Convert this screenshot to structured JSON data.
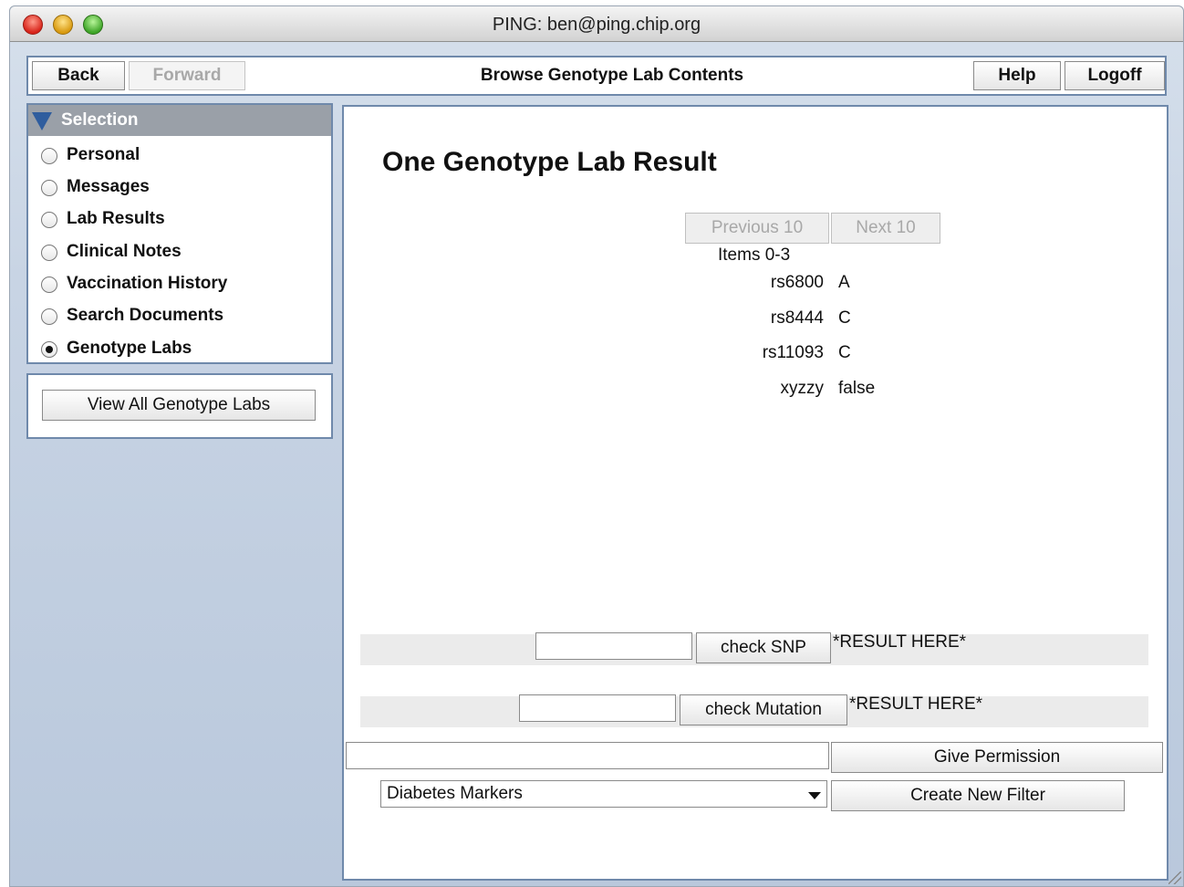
{
  "window": {
    "title": "PING: ben@ping.chip.org"
  },
  "navbar": {
    "back_label": "Back",
    "forward_label": "Forward",
    "title": "Browse Genotype Lab Contents",
    "help_label": "Help",
    "logoff_label": "Logoff"
  },
  "selection": {
    "header": "Selection",
    "items": [
      {
        "label": "Personal",
        "selected": false
      },
      {
        "label": "Messages",
        "selected": false
      },
      {
        "label": "Lab Results",
        "selected": false
      },
      {
        "label": "Clinical Notes",
        "selected": false
      },
      {
        "label": "Vaccination History",
        "selected": false
      },
      {
        "label": "Search Documents",
        "selected": false
      },
      {
        "label": "Genotype Labs",
        "selected": true
      }
    ],
    "view_all_label": "View All Genotype Labs"
  },
  "main": {
    "heading": "One Genotype Lab Result",
    "prev_label": "Previous 10",
    "next_label": "Next 10",
    "items_range": "Items 0-3",
    "results": [
      {
        "key": "rs6800",
        "value": "A"
      },
      {
        "key": "rs8444",
        "value": "C"
      },
      {
        "key": "rs11093",
        "value": "C"
      },
      {
        "key": "xyzzy",
        "value": "false"
      }
    ],
    "snp_input_value": "",
    "check_snp_label": "check SNP",
    "snp_result": "*RESULT HERE*",
    "mutation_input_value": "",
    "check_mutation_label": "check Mutation",
    "mutation_result": "*RESULT HERE*",
    "permission_input_value": "",
    "give_permission_label": "Give Permission",
    "filter_selected": "Diabetes Markers",
    "create_filter_label": "Create New Filter"
  },
  "colors": {
    "panel_border": "#6f89ab",
    "header_gray": "#9aa0a8",
    "triangle_blue": "#2f5d9e"
  }
}
